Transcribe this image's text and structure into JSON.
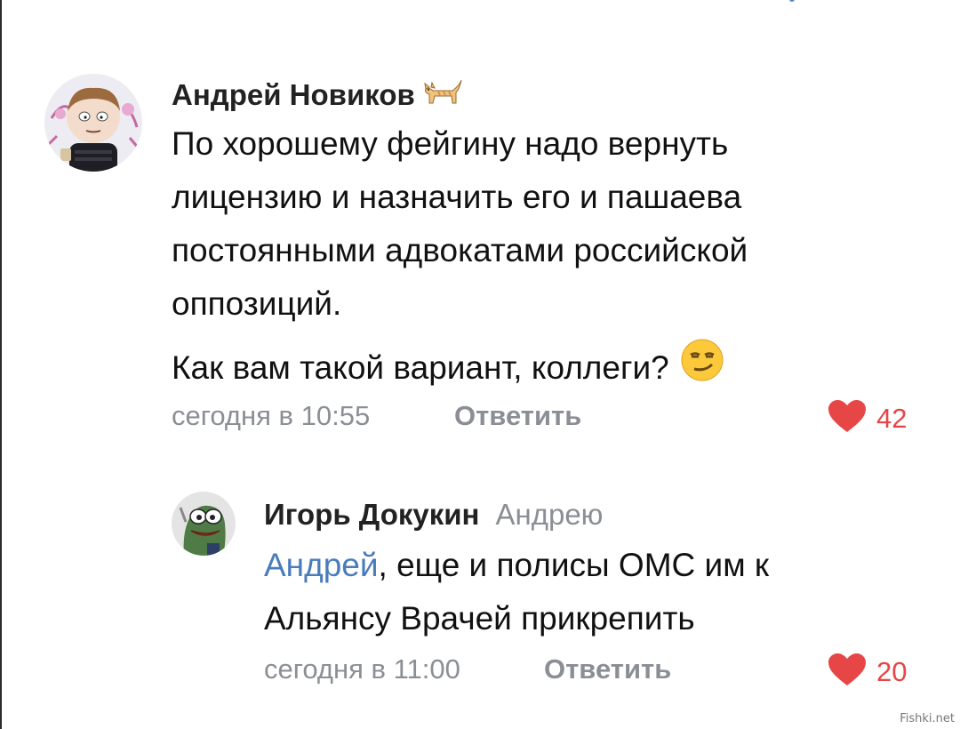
{
  "comment": {
    "author": "Андрей Новиков",
    "author_badge_icon": "cat-icon",
    "text_lines": [
      "По хорошему фейгину надо вернуть",
      "лицензию и назначить его и пашаева",
      "постоянными адвокатами российской",
      "оппозиций.",
      "Как вам такой вариант, коллеги?"
    ],
    "text_emoji_icon": "smirking-face-icon",
    "timestamp": "сегодня в 10:55",
    "reply_label": "Ответить",
    "likes": "42"
  },
  "reply": {
    "author": "Игорь Докукин",
    "reply_to": "Андрею",
    "mention": "Андрей",
    "text_first_rest": ", еще и полисы ОМС им к",
    "text_second": "Альянсу Врачей прикрепить",
    "timestamp": "сегодня в 11:00",
    "reply_label": "Ответить",
    "likes": "20"
  },
  "watermark": "Fishki.net",
  "colors": {
    "link": "#4a7cbc",
    "meta": "#8b8f95",
    "like": "#e64646"
  }
}
